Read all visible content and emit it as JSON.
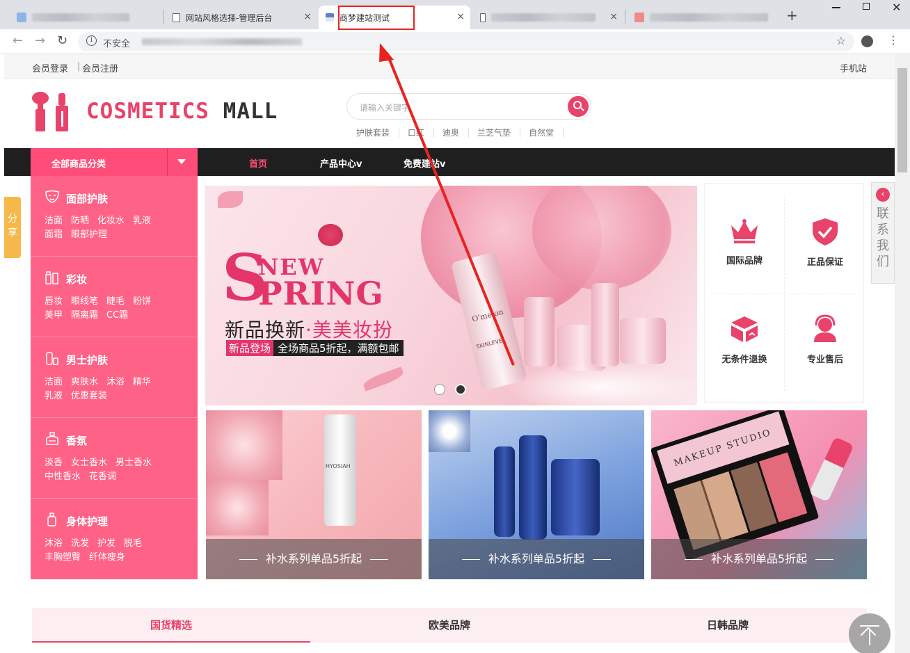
{
  "browser": {
    "tabs": [
      {
        "title": "",
        "blurred": true
      },
      {
        "title": "网站风格选择-管理后台",
        "blurred": false
      },
      {
        "title": "商梦建站测试",
        "blurred": false,
        "active": true
      },
      {
        "title": "",
        "blurred": true
      },
      {
        "title": "",
        "blurred": true
      }
    ],
    "close_glyph": "×",
    "newtab_glyph": "+",
    "security_label": "不安全"
  },
  "topbar": {
    "login": "会员登录",
    "sep": "|",
    "register": "会员注册",
    "mobile": "手机站"
  },
  "logo": {
    "part1": "COSMETICS",
    "part2": "MALL",
    "accent": "#e8436a"
  },
  "search": {
    "placeholder": "请输入关键字",
    "hotkeys": [
      "护肤套装",
      "口红",
      "迪奥",
      "兰芝气垫",
      "自然堂"
    ]
  },
  "nav": {
    "all_label": "全部商品分类",
    "items": [
      "首页",
      "产品中心v",
      "免费建站v"
    ]
  },
  "categories": [
    {
      "title": "面部护肤",
      "icon": "face-mask-icon",
      "links": [
        "洁面",
        "防晒",
        "化妆水",
        "乳液",
        "面霜",
        "眼部护理"
      ]
    },
    {
      "title": "彩妆",
      "icon": "makeup-icon",
      "links": [
        "唇妆",
        "眼线笔",
        "睫毛",
        "粉饼",
        "美甲",
        "隔离霜",
        "CC霜"
      ]
    },
    {
      "title": "男士护肤",
      "icon": "men-care-icon",
      "links": [
        "洁面",
        "爽肤水",
        "沐浴",
        "精华",
        "乳液",
        "优惠套装"
      ]
    },
    {
      "title": "香氛",
      "icon": "perfume-icon",
      "links": [
        "淡香",
        "女士香水",
        "男士香水",
        "中性香水",
        "花香调"
      ]
    },
    {
      "title": "身体护理",
      "icon": "body-care-icon",
      "links": [
        "沐浴",
        "洗发",
        "护发",
        "脱毛",
        "丰胸塑臀",
        "纤体瘦身"
      ]
    }
  ],
  "side": {
    "share": "分享",
    "contact": "联系我们"
  },
  "banner": {
    "big_s": "S",
    "new": "NEW",
    "pring": "PRING",
    "line1_a": "新品换新",
    "line1_dot": "·",
    "line1_b": "美美妆扮",
    "tag1": "新品登场",
    "tag2": "全场商品5折起，满额包邮",
    "bottle_brand": "O'melon",
    "bottle_line": "SKINLEVEL",
    "active_slide": 2,
    "slide_count": 2
  },
  "features": [
    {
      "label": "国际品牌",
      "icon": "crown-icon"
    },
    {
      "label": "正品保证",
      "icon": "shield-check-icon"
    },
    {
      "label": "无条件退换",
      "icon": "return-box-icon"
    },
    {
      "label": "专业售后",
      "icon": "customer-service-icon"
    }
  ],
  "promos": [
    {
      "caption": "补水系列单品5折起",
      "bottle_text": "HYOSIAH"
    },
    {
      "caption": "补水系列单品5折起"
    },
    {
      "caption": "补水系列单品5折起",
      "palette_text": "MAKEUP STUDIO"
    }
  ],
  "brand_tabs": [
    {
      "label": "国货精选",
      "active": true
    },
    {
      "label": "欧美品牌",
      "active": false
    },
    {
      "label": "日韩品牌",
      "active": false
    }
  ],
  "colors": {
    "brand_pink": "#e8436a",
    "menu_pink": "#fe6286",
    "nav_dark": "#1f1f1f",
    "annotation_red": "#e8231f"
  }
}
